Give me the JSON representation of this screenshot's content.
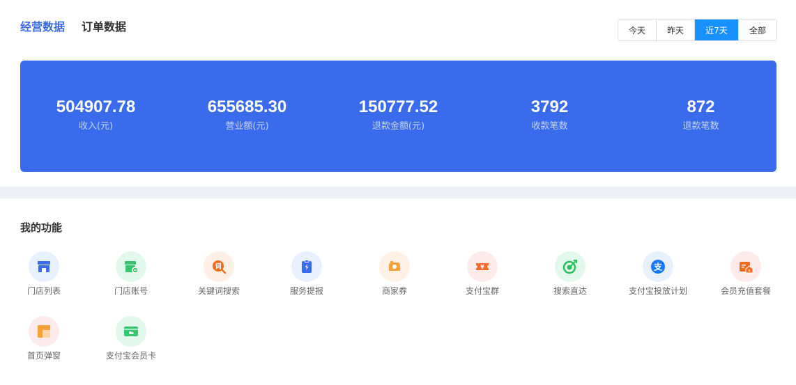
{
  "tabs": [
    {
      "label": "经营数据",
      "active": true
    },
    {
      "label": "订单数据",
      "active": false
    }
  ],
  "range": [
    {
      "label": "今天",
      "active": false
    },
    {
      "label": "昨天",
      "active": false
    },
    {
      "label": "近7天",
      "active": true
    },
    {
      "label": "全部",
      "active": false
    }
  ],
  "stats": [
    {
      "value": "504907.78",
      "label": "收入(元)"
    },
    {
      "value": "655685.30",
      "label": "营业额(元)"
    },
    {
      "value": "150777.52",
      "label": "退款金额(元)"
    },
    {
      "value": "3792",
      "label": "收款笔数"
    },
    {
      "value": "872",
      "label": "退款笔数"
    }
  ],
  "features": {
    "title": "我的功能",
    "items": [
      {
        "label": "门店列表",
        "icon": "store-icon",
        "bg": "#e8f0fd",
        "color": "#3a6bed"
      },
      {
        "label": "门店账号",
        "icon": "store-account-icon",
        "bg": "#e3f8ec",
        "color": "#36c46f"
      },
      {
        "label": "关键词搜索",
        "icon": "keyword-search-icon",
        "bg": "#fdeee6",
        "color": "#f26b1d"
      },
      {
        "label": "服务提报",
        "icon": "service-report-icon",
        "bg": "#e8f0fd",
        "color": "#3a6bed"
      },
      {
        "label": "商家券",
        "icon": "merchant-coupon-icon",
        "bg": "#fdf1e6",
        "color": "#f5a23a"
      },
      {
        "label": "支付宝群",
        "icon": "alipay-group-icon",
        "bg": "#fdeaea",
        "color": "#f56a2a"
      },
      {
        "label": "搜索直达",
        "icon": "search-direct-icon",
        "bg": "#e3f8ec",
        "color": "#2bbf5c"
      },
      {
        "label": "支付宝投放计划",
        "icon": "alipay-logo-icon",
        "bg": "#e8f0fd",
        "color": "#1677ff"
      },
      {
        "label": "会员充值套餐",
        "icon": "member-recharge-icon",
        "bg": "#fdeaea",
        "color": "#f26b1d"
      },
      {
        "label": "首页弹窗",
        "icon": "homepage-popup-icon",
        "bg": "#fdeaea",
        "color": "#f5a23a"
      },
      {
        "label": "支付宝会员卡",
        "icon": "member-card-icon",
        "bg": "#e3f8ec",
        "color": "#36c46f"
      }
    ]
  }
}
